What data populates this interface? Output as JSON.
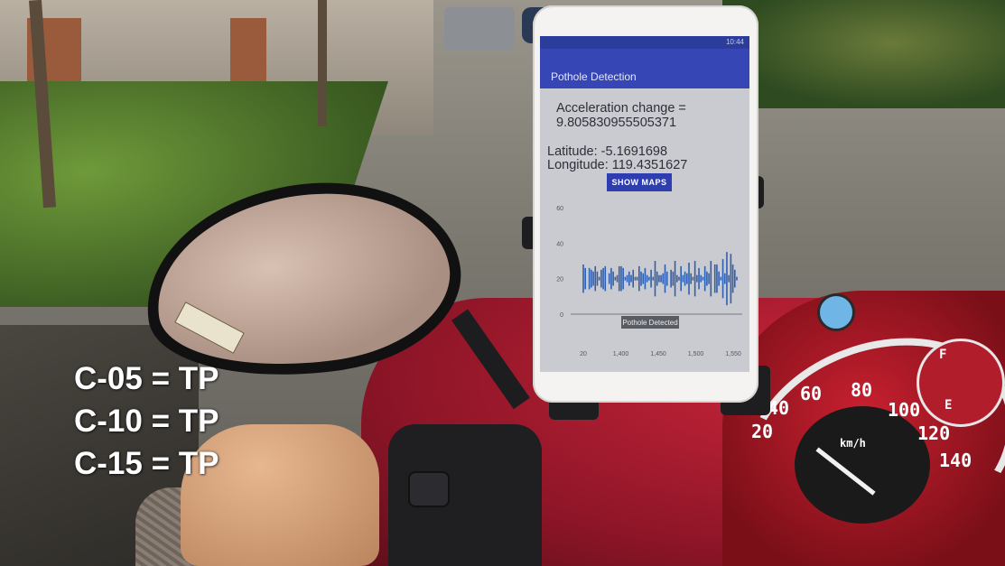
{
  "app": {
    "title": "Pothole Detection",
    "acceleration_label": "Acceleration change =",
    "acceleration_value": "9.805830955505371",
    "latitude_label": "Latitude: -5.1691698",
    "longitude_label": "Longitude: 119.4351627",
    "show_maps_label": "SHOW MAPS",
    "detection_badge": "Pothole Detected",
    "status_time": "10:44"
  },
  "chart_data": {
    "type": "line",
    "yticks": [
      "60",
      "40",
      "20",
      "0"
    ],
    "xticks": [
      "20",
      "1,400",
      "1,450",
      "1,500",
      "1,550"
    ],
    "ylim": [
      0,
      60
    ],
    "series": [
      {
        "color": "#2f5fb0",
        "values": [
          28,
          14,
          20,
          26,
          15,
          24,
          27,
          16,
          21,
          25,
          14,
          27,
          20,
          17,
          26,
          24,
          19,
          22,
          27,
          13,
          26,
          19,
          22,
          24,
          18,
          25,
          21,
          19,
          27,
          16,
          23,
          26,
          18,
          21,
          25,
          19,
          30,
          24,
          18,
          22,
          17,
          28,
          24,
          20,
          25,
          16,
          30,
          22,
          19,
          27,
          18,
          24,
          17,
          29,
          23,
          21,
          30,
          18,
          26,
          22,
          19,
          27,
          24,
          17,
          30,
          20,
          12,
          28,
          24,
          21,
          31,
          17,
          35,
          22,
          6,
          28,
          25,
          19
        ]
      }
    ]
  },
  "speedometer": {
    "numbers": [
      "60",
      "80",
      "100",
      "40",
      "120",
      "20",
      "140",
      "F",
      "E"
    ],
    "unit": "km/h"
  },
  "captions": [
    "C-05 = TP",
    "C-10 = TP",
    "C-15 = TP"
  ],
  "colors": {
    "appbar": "#3646b4",
    "button": "#2e3eb0",
    "scooter": "#b91f33"
  }
}
